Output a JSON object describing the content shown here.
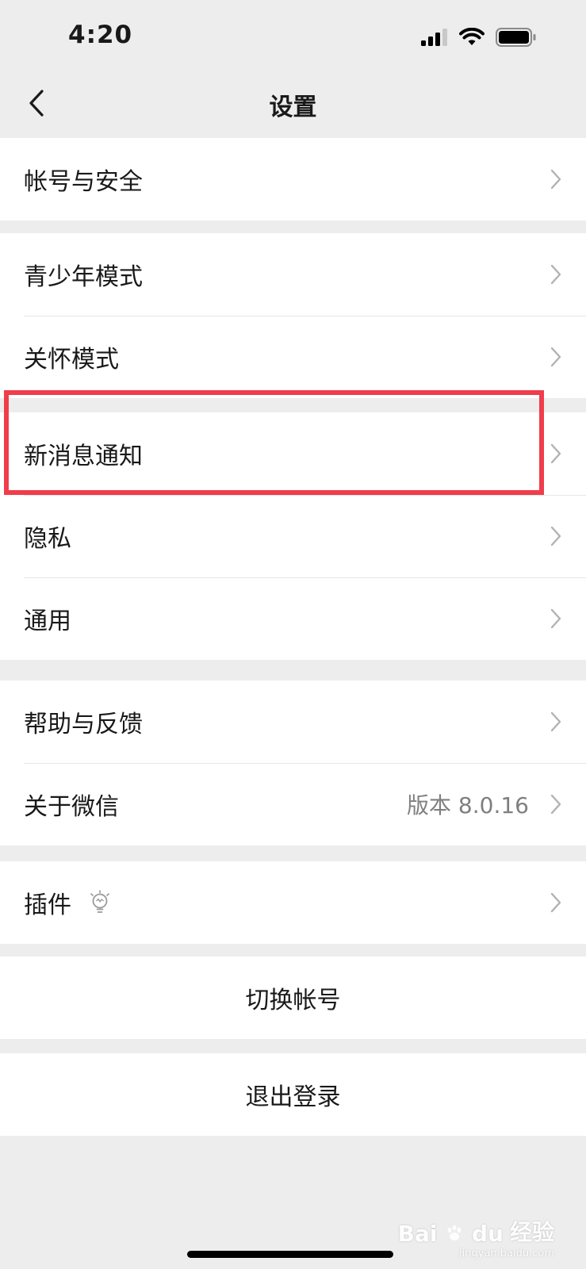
{
  "status_bar": {
    "time": "4:20"
  },
  "nav": {
    "title": "设置",
    "back_icon": "chevron-left-icon"
  },
  "groups": [
    {
      "items": [
        {
          "label": "帐号与安全"
        }
      ]
    },
    {
      "items": [
        {
          "label": "青少年模式"
        },
        {
          "label": "关怀模式"
        }
      ]
    },
    {
      "items": [
        {
          "label": "新消息通知"
        },
        {
          "label": "隐私"
        },
        {
          "label": "通用"
        }
      ]
    },
    {
      "items": [
        {
          "label": "帮助与反馈"
        },
        {
          "label": "关于微信",
          "value": "版本 8.0.16"
        }
      ]
    },
    {
      "items": [
        {
          "label": "插件",
          "icon": "lightbulb-icon"
        }
      ]
    }
  ],
  "actions": {
    "switch_account": "切换帐号",
    "logout": "退出登录"
  },
  "annotation": {
    "color": "#f03c4b"
  },
  "watermark": {
    "brand": "Bai",
    "brand2": "du",
    "cn": "经验",
    "sub": "jingyan.baidu.com"
  }
}
